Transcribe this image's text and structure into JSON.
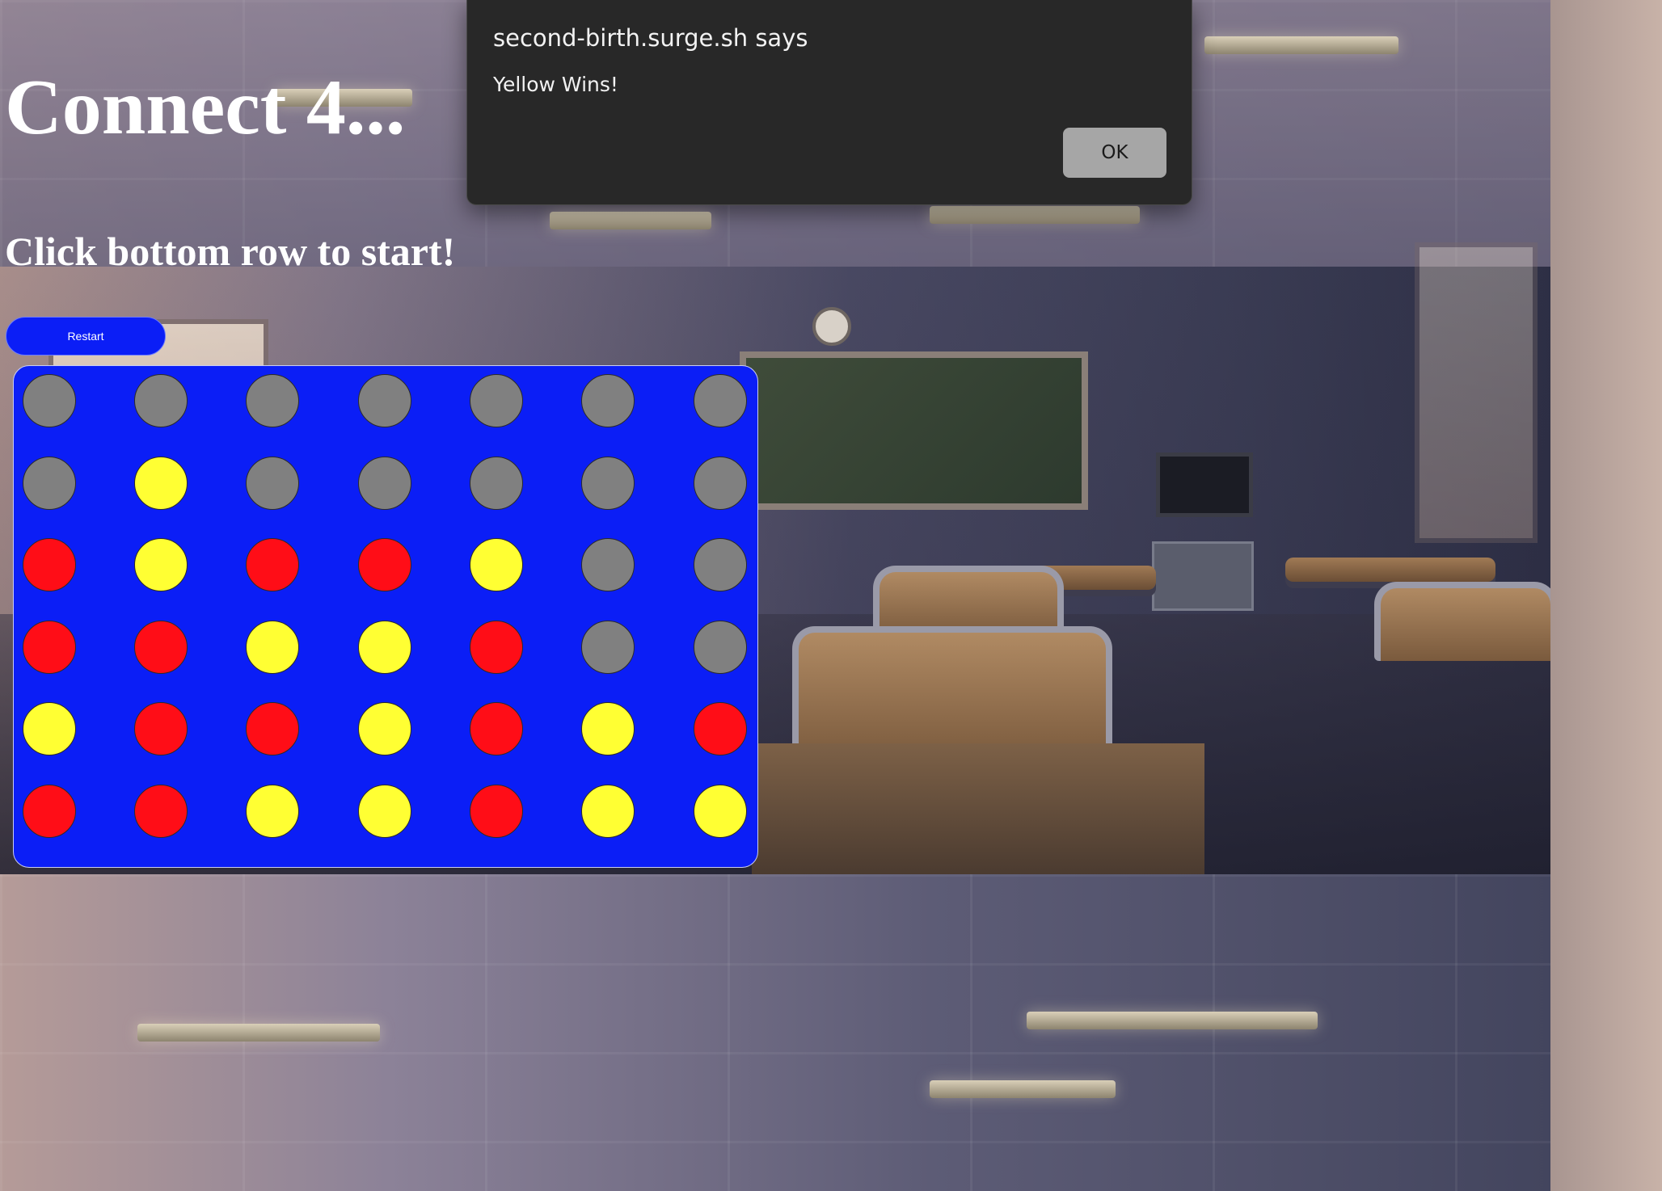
{
  "page": {
    "title": "Connect 4...",
    "subtitle": "Click bottom row to start!",
    "restart_label": "Restart"
  },
  "board": {
    "rows": 6,
    "cols": 7,
    "cells": [
      [
        "empty",
        "empty",
        "empty",
        "empty",
        "empty",
        "empty",
        "empty"
      ],
      [
        "empty",
        "yellow",
        "empty",
        "empty",
        "empty",
        "empty",
        "empty"
      ],
      [
        "red",
        "yellow",
        "red",
        "red",
        "yellow",
        "empty",
        "empty"
      ],
      [
        "red",
        "red",
        "yellow",
        "yellow",
        "red",
        "empty",
        "empty"
      ],
      [
        "yellow",
        "red",
        "red",
        "yellow",
        "red",
        "yellow",
        "red"
      ],
      [
        "red",
        "red",
        "yellow",
        "yellow",
        "red",
        "yellow",
        "yellow"
      ]
    ]
  },
  "colors": {
    "board": "#0b1ef6",
    "red": "#ff0d17",
    "yellow": "#ffff33",
    "empty": "#808080"
  },
  "dialog": {
    "title": "second-birth.surge.sh says",
    "message": "Yellow Wins!",
    "ok_label": "OK"
  }
}
